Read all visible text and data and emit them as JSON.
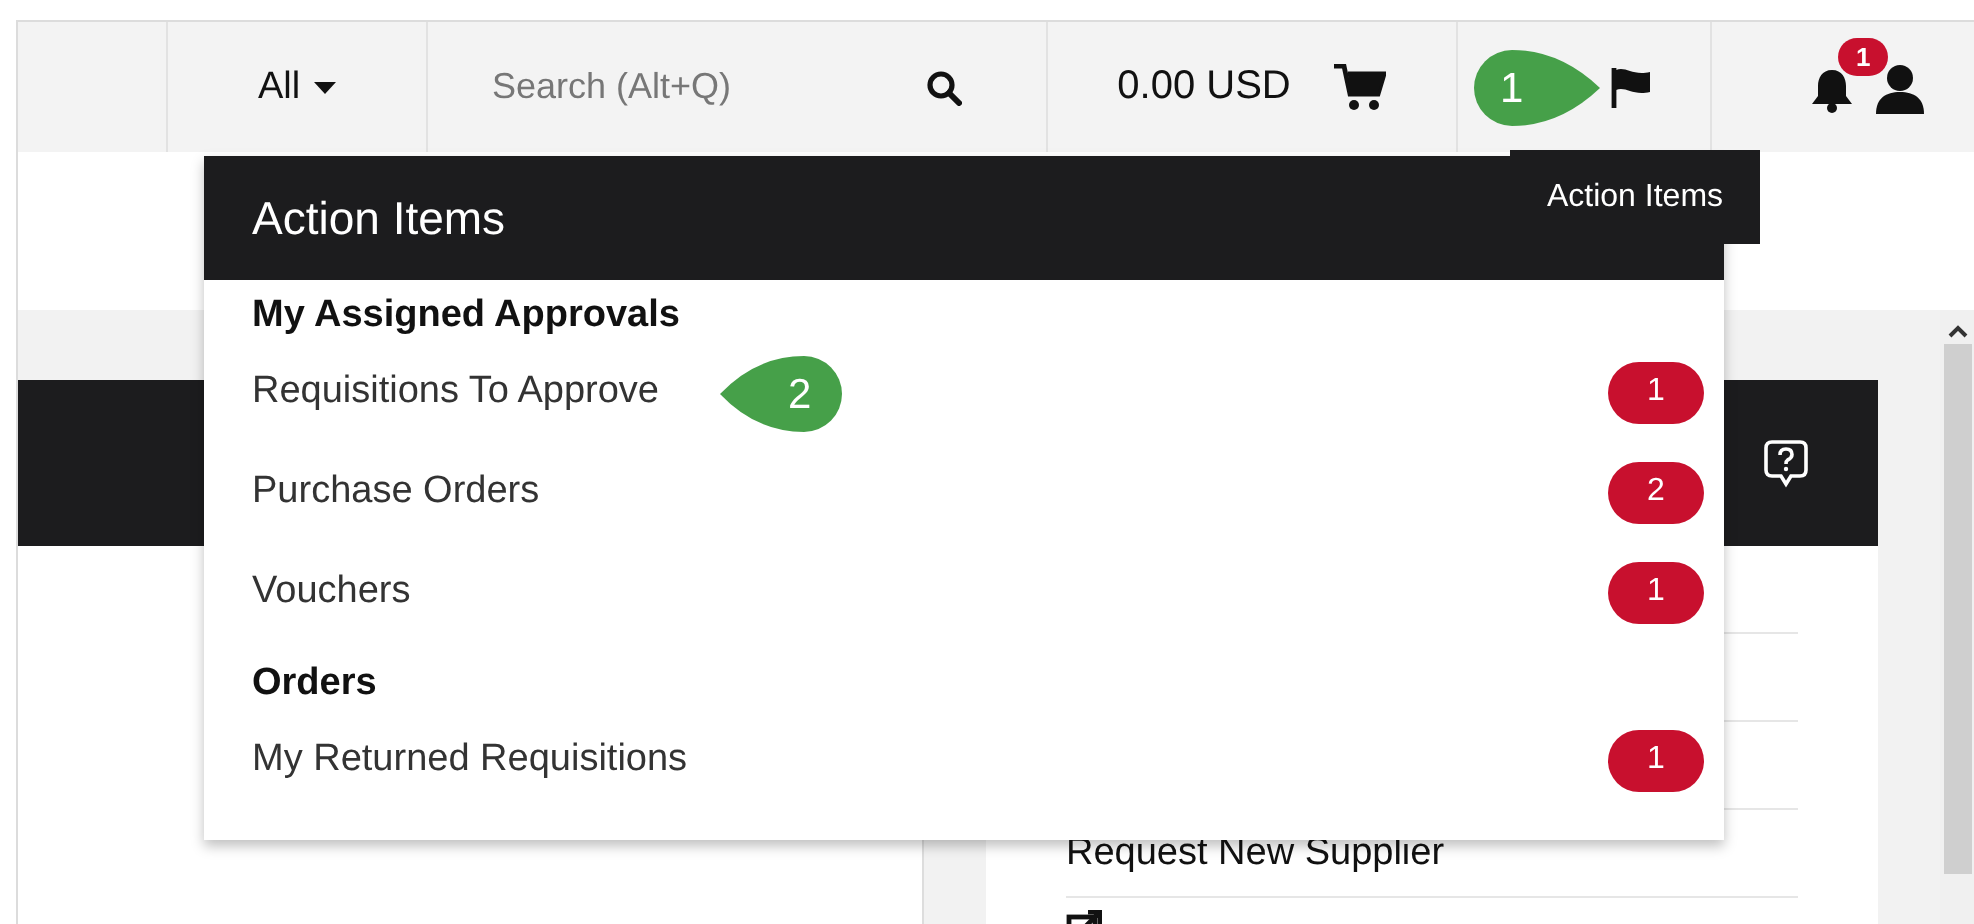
{
  "header": {
    "scope": "All",
    "search_placeholder": "Search (Alt+Q)",
    "cart_total": "0.00 USD",
    "notifications_count": "1"
  },
  "action_items_menu": {
    "title": "Action Items",
    "sections": [
      {
        "heading": "My Assigned Approvals",
        "items": [
          {
            "label": "Requisitions To Approve",
            "count": "1"
          },
          {
            "label": "Purchase Orders",
            "count": "2"
          },
          {
            "label": "Vouchers",
            "count": "1"
          }
        ]
      },
      {
        "heading": "Orders",
        "items": [
          {
            "label": "My Returned Requisitions",
            "count": "1"
          }
        ]
      }
    ]
  },
  "tooltip": "Action Items",
  "callouts": [
    {
      "number": "1",
      "kind": "rightward"
    },
    {
      "number": "2",
      "kind": "leftward"
    }
  ],
  "side_card": {
    "links": [
      "Request New Supplier"
    ]
  }
}
